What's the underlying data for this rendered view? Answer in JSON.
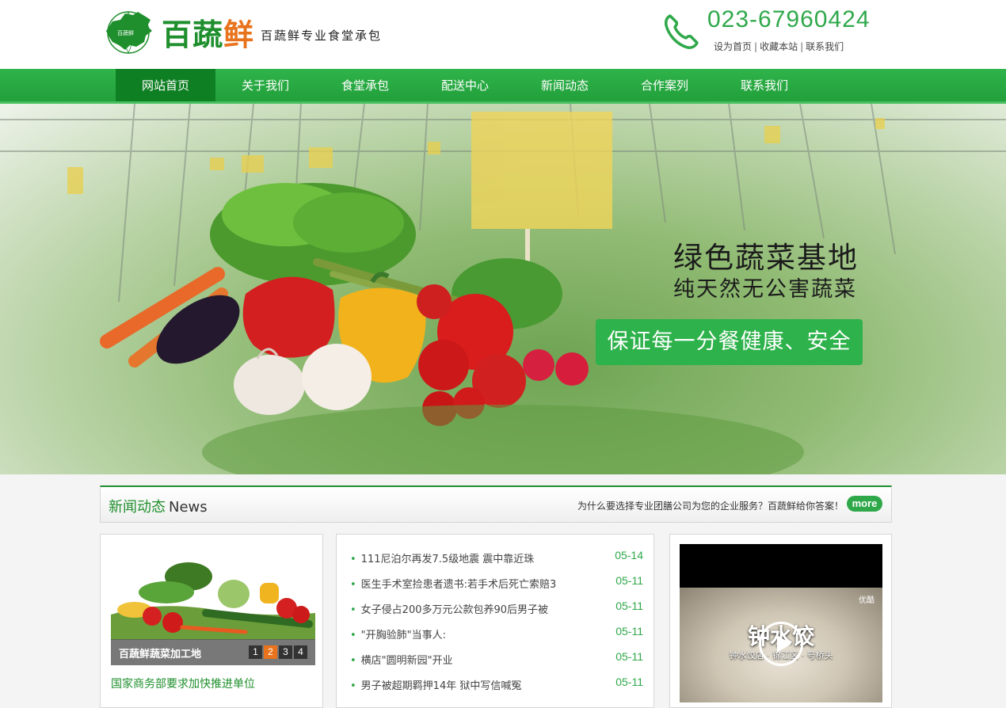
{
  "header": {
    "brand_part1": "百蔬",
    "brand_part2": "鲜",
    "slogan": "百蔬鲜专业食堂承包",
    "phone": "023-67960424",
    "links": [
      "设为首页",
      "收藏本站",
      "联系我们"
    ]
  },
  "nav": {
    "items": [
      "网站首页",
      "关于我们",
      "食堂承包",
      "配送中心",
      "新闻动态",
      "合作案列",
      "联系我们"
    ],
    "active_index": 0
  },
  "banner": {
    "title": "绿色蔬菜基地",
    "subtitle": "纯天然无公害蔬菜",
    "badge": "保证每一分餐健康、安全"
  },
  "news_section": {
    "title_cn": "新闻动态",
    "title_en": "News",
    "tagline": "为什么要选择专业团膳公司为您的企业服务？百蔬鲜给你答案！",
    "more": "more"
  },
  "feature": {
    "caption": "百蔬鲜蔬菜加工地",
    "pages": [
      "1",
      "2",
      "3",
      "4"
    ],
    "active_page": 1,
    "link": "国家商务部要求加快推进单位"
  },
  "news_list": [
    {
      "title": "111尼泊尔再发7.5级地震 震中靠近珠",
      "date": "05-14"
    },
    {
      "title": "医生手术室捡患者遗书:若手术后死亡索赔3",
      "date": "05-11"
    },
    {
      "title": "女子侵占200多万元公款包养90后男子被",
      "date": "05-11"
    },
    {
      "title": "\"开胸验肺\"当事人:",
      "date": "05-11"
    },
    {
      "title": "横店\"圆明新园\"开业",
      "date": "05-11"
    },
    {
      "title": "男子被超期羁押14年 狱中写信喊冤",
      "date": "05-11"
    }
  ],
  "video": {
    "title": "钟水饺",
    "subtitle": "钟水饺店 · 锦江区 · 号桥头",
    "corner": "优酷"
  },
  "colors": {
    "brand_green": "#1f8f2d",
    "nav_green": "#2fb34a",
    "accent_orange": "#e8731c"
  }
}
